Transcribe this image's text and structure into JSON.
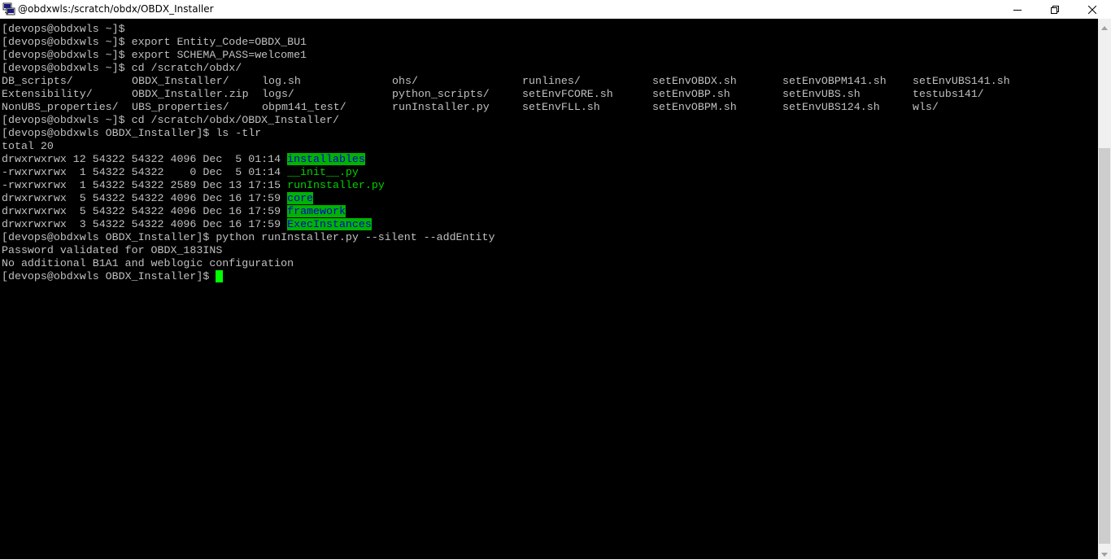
{
  "window": {
    "title": "@obdxwls:/scratch/obdx/OBDX_Installer",
    "app_icon": "putty-icon",
    "controls": [
      "minimize-icon",
      "maximize-icon",
      "close-icon"
    ]
  },
  "colors": {
    "terminal_bg": "#000000",
    "terminal_fg": "#c0c0c0",
    "dir_highlight_bg": "#00b300",
    "dir_highlight_fg": "#0000cc",
    "exec_fg": "#00d000",
    "cursor": "#00ff00"
  },
  "terminal": {
    "lines": [
      "[devops@obdxwls ~]$",
      "[devops@obdxwls ~]$ export Entity_Code=OBDX_BU1",
      "[devops@obdxwls ~]$ export SCHEMA_PASS=welcome1",
      "[devops@obdxwls ~]$ cd /scratch/obdx/"
    ],
    "ls_rows": [
      [
        "DB_scripts/",
        "OBDX_Installer/",
        "log.sh",
        "ohs/",
        "runlines/",
        "setEnvOBDX.sh",
        "setEnvOBPM141.sh",
        "setEnvUBS141.sh"
      ],
      [
        "Extensibility/",
        "OBDX_Installer.zip",
        "logs/",
        "python_scripts/",
        "setEnvFCORE.sh",
        "setEnvOBP.sh",
        "setEnvUBS.sh",
        "testubs141/"
      ],
      [
        "NonUBS_properties/",
        "UBS_properties/",
        "obpm141_test/",
        "runInstaller.py",
        "setEnvFLL.sh",
        "setEnvOBPM.sh",
        "setEnvUBS124.sh",
        "wls/"
      ]
    ],
    "lines2": [
      "[devops@obdxwls ~]$ cd /scratch/obdx/OBDX_Installer/",
      "[devops@obdxwls OBDX_Installer]$ ls -tlr",
      "total 20"
    ],
    "lsl_rows": [
      {
        "meta": "drwxrwxrwx 12 54322 54322 4096 Dec  5 01:14 ",
        "name": "installables"
      },
      {
        "meta": "-rwxrwxrwx  1 54322 54322    0 Dec  5 01:14 ",
        "name": "__init__.py"
      },
      {
        "meta": "-rwxrwxrwx  1 54322 54322 2589 Dec 13 17:15 ",
        "name": "runInstaller.py"
      },
      {
        "meta": "drwxrwxrwx  5 54322 54322 4096 Dec 16 17:59 ",
        "name": "core"
      },
      {
        "meta": "drwxrwxrwx  5 54322 54322 4096 Dec 16 17:59 ",
        "name": "framework"
      },
      {
        "meta": "drwxrwxrwx  3 54322 54322 4096 Dec 16 17:59 ",
        "name": "ExecInstances"
      }
    ],
    "lines3": [
      "[devops@obdxwls OBDX_Installer]$ python runInstaller.py --silent --addEntity",
      "Password validated for OBDX_183INS",
      "No additional B1A1 and weblogic configuration",
      "[devops@obdxwls OBDX_Installer]$ "
    ]
  }
}
